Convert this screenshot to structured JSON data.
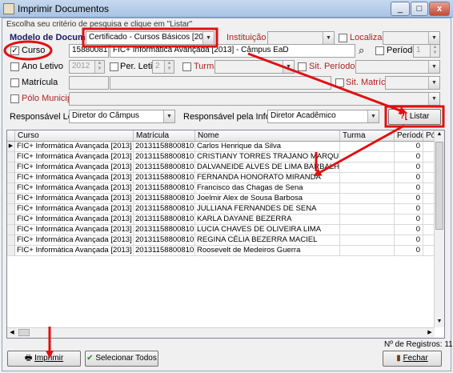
{
  "window": {
    "title": "Imprimir Documentos",
    "minimize": "_",
    "maximize": "□",
    "close": "x"
  },
  "criteria_caption": "Escolha seu critério de pesquisa e clique em \"Listar\"",
  "modelo": {
    "label": "Modelo de Documento",
    "value": "Certificado - Cursos Básicos [2012]"
  },
  "instituicao": {
    "label": "Instituição",
    "value": ""
  },
  "localizacao": {
    "label": "Localização",
    "value": ""
  },
  "curso": {
    "label": "Curso",
    "checked": true,
    "code": "15880081",
    "value": "FIC+ Informática Avançada [2013] - Câmpus EaD"
  },
  "periodo": {
    "label": "Período",
    "value": "1"
  },
  "ano_letivo": {
    "label": "Ano Letivo",
    "value": "2012"
  },
  "per_letivo": {
    "label": "Per. Letivo",
    "value": "2"
  },
  "turma": {
    "label": "Turma",
    "value": ""
  },
  "sit_periodo": {
    "label": "Sit. Período",
    "value": ""
  },
  "matricula_filter": {
    "label": "Matrícula",
    "value": ""
  },
  "sit_matricula": {
    "label": "Sit. Matrícula",
    "value": ""
  },
  "polo": {
    "label": "Pólo Municipal",
    "value": ""
  },
  "resp_legal": {
    "label": "Responsável Legal",
    "value": "Diretor do Câmpus"
  },
  "resp_info": {
    "label": "Responsável pela Informação",
    "value": "Diretor Acadêmico"
  },
  "listar_button": "Listar",
  "table": {
    "columns": [
      "Curso",
      "Matrícula",
      "Nome",
      "Turma",
      "Período",
      "Pólo M"
    ],
    "rows": [
      [
        "FIC+ Informática Avançada [2013] - Câmpu",
        "20131158800810",
        "Carlos Henrique da Silva",
        "",
        "0",
        ""
      ],
      [
        "FIC+ Informática Avançada [2013] - Câmpu",
        "20131158800810",
        "CRISTIANY TORRES TRAJANO MARQUES DOS",
        "",
        "0",
        ""
      ],
      [
        "FIC+ Informática Avançada [2013] - Câmpu",
        "20131158800810",
        "DALVANEIDE ALVES DE LIMA BARBALHO",
        "",
        "0",
        ""
      ],
      [
        "FIC+ Informática Avançada [2013] - Câmpu",
        "20131158800810",
        "FERNANDA HONORATO MIRANDA",
        "",
        "0",
        ""
      ],
      [
        "FIC+ Informática Avançada [2013] - Câmpu",
        "20131158800810",
        "Francisco das Chagas de Sena",
        "",
        "0",
        ""
      ],
      [
        "FIC+ Informática Avançada [2013] - Câmpu",
        "20131158800810",
        "Joelmir Alex de Sousa Barbosa",
        "",
        "0",
        ""
      ],
      [
        "FIC+ Informática Avançada [2013] - Câmpu",
        "20131158800810",
        "JULLIANA FERNANDES DE SENA",
        "",
        "0",
        ""
      ],
      [
        "FIC+ Informática Avançada [2013] - Câmpu",
        "20131158800810",
        "KARLA DAYANE BEZERRA",
        "",
        "0",
        ""
      ],
      [
        "FIC+ Informática Avançada [2013] - Câmpu",
        "20131158800810",
        "LUCIA CHAVES DE OLIVEIRA LIMA",
        "",
        "0",
        ""
      ],
      [
        "FIC+ Informática Avançada [2013] - Câmpu",
        "20131158800810",
        "REGINA CÉLIA BEZERRA MACIEL",
        "",
        "0",
        ""
      ],
      [
        "FIC+ Informática Avançada [2013] - Câmpu",
        "20131158800810",
        "Roosevelt de Medeiros Guerra",
        "",
        "0",
        ""
      ]
    ]
  },
  "status": {
    "records": "Nº de Registros: 11"
  },
  "imprimir_button": "Imprimir",
  "selecionar_button": "Selecionar Todos",
  "fechar_button": "Fechar",
  "colors": {
    "annotation": "#e01010",
    "title_bg": "#b9cfea",
    "label_red": "#b22222"
  }
}
